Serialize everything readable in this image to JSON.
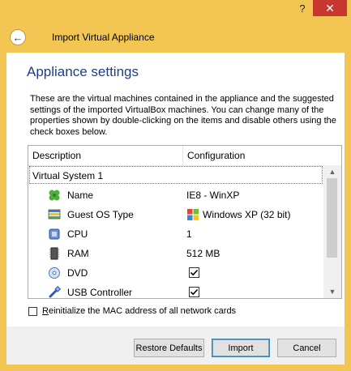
{
  "window": {
    "help_label": "?",
    "close_label": "✕",
    "title": "Import Virtual Appliance"
  },
  "page": {
    "heading": "Appliance settings",
    "intro": "These are the virtual machines contained in the appliance and the suggested settings of the imported VirtualBox machines. You can change many of the properties shown by double-clicking on the items and disable others using the check boxes below."
  },
  "tree": {
    "columns": [
      "Description",
      "Configuration"
    ],
    "system": "Virtual System 1",
    "rows": [
      {
        "label": "Name",
        "value": "IE8 - WinXP",
        "icon": "name-icon"
      },
      {
        "label": "Guest OS Type",
        "value": "Windows XP (32 bit)",
        "icon": "os-type-icon",
        "value_icon": "windows-xp-icon"
      },
      {
        "label": "CPU",
        "value": "1",
        "icon": "cpu-icon"
      },
      {
        "label": "RAM",
        "value": "512 MB",
        "icon": "ram-icon"
      },
      {
        "label": "DVD",
        "checked": true,
        "icon": "dvd-icon"
      },
      {
        "label": "USB Controller",
        "checked": true,
        "icon": "usb-icon"
      }
    ]
  },
  "options": {
    "reinit_first": "R",
    "reinit_rest": "einitialize the MAC address of all network cards",
    "reinit_checked": false
  },
  "buttons": {
    "defaults": "Restore Defaults",
    "import": "Import",
    "cancel": "Cancel"
  },
  "colors": {
    "title_bar": "#f3c653",
    "close": "#c7372f",
    "heading": "#1c3d8c"
  }
}
